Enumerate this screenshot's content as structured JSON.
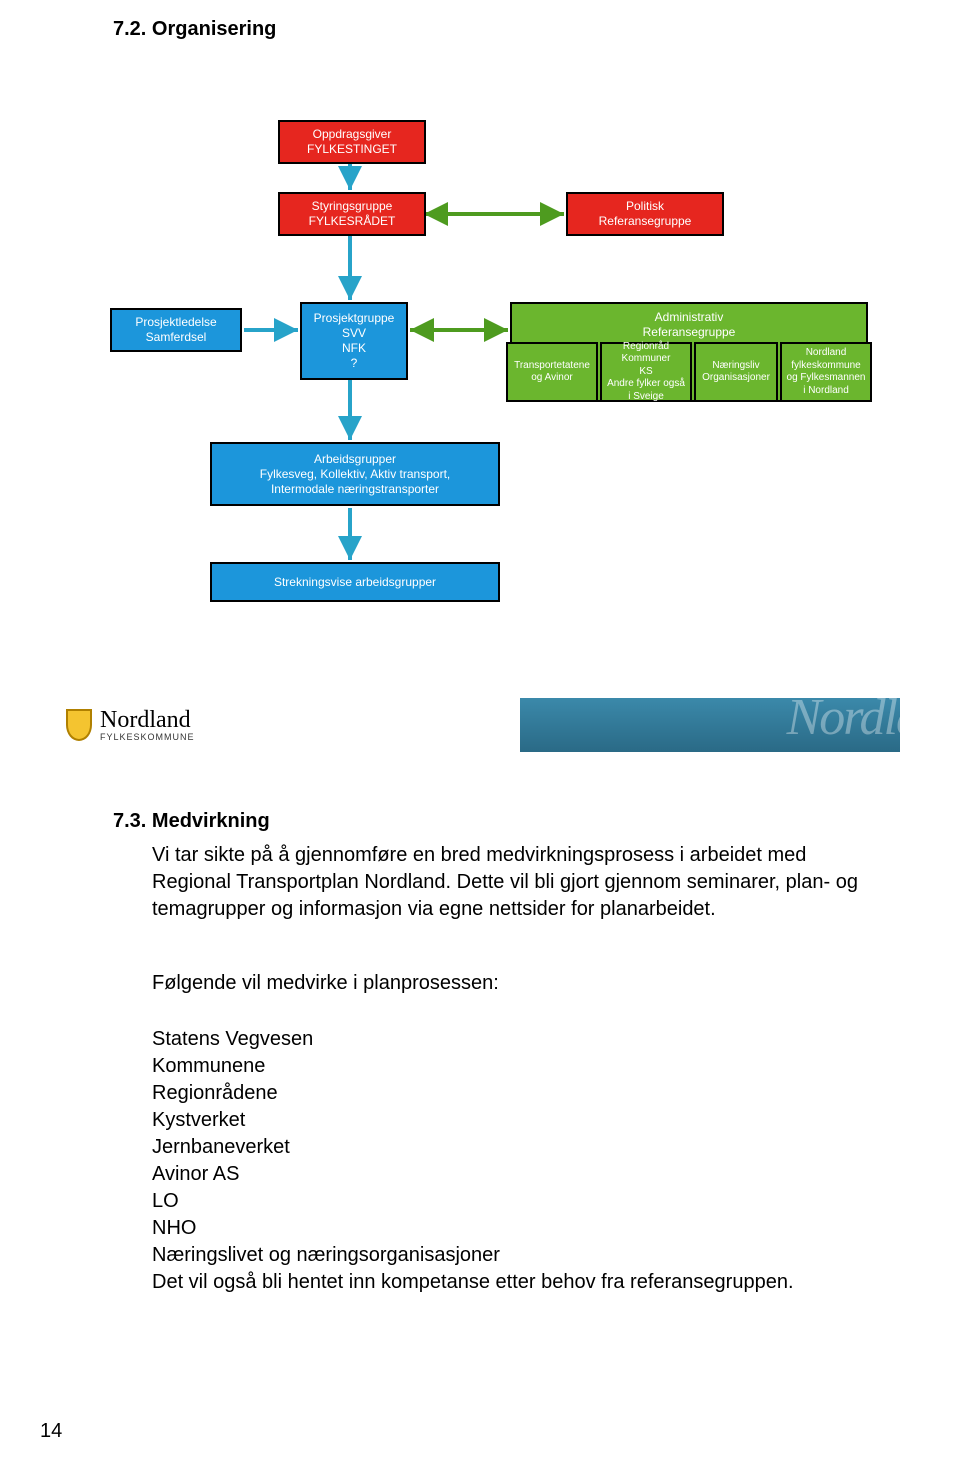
{
  "section1": {
    "number": "7.2.",
    "title": "Organisering"
  },
  "diagram": {
    "oppdragsgiver": {
      "line1": "Oppdragsgiver",
      "line2": "FYLKESTINGET"
    },
    "styringsgruppe": {
      "line1": "Styringsgruppe",
      "line2": "FYLKESRÅDET"
    },
    "politisk": {
      "line1": "Politisk",
      "line2": "Referansegruppe"
    },
    "prosjektledelse": {
      "line1": "Prosjektledelse",
      "line2": "Samferdsel"
    },
    "prosjektgruppe": {
      "line1": "Prosjektgruppe",
      "line2": "SVV",
      "line3": "NFK",
      "line4": "?"
    },
    "administrativ": {
      "line1": "Administrativ",
      "line2": "Referansegruppe"
    },
    "sub1": {
      "line1": "Transportetatene",
      "line2": "og Avinor"
    },
    "sub2": {
      "line1": "Regionråd",
      "line2": "Kommuner",
      "line3": "KS",
      "line4": "Andre fylker også",
      "line5": "i Sveige"
    },
    "sub3": {
      "line1": "Næringsliv",
      "line2": "Organisasjoner"
    },
    "sub4": {
      "line1": "Nordland",
      "line2": "fylkeskommune",
      "line3": "og Fylkesmannen",
      "line4": "i Nordland"
    },
    "arbeidsgrupper": {
      "line1": "Arbeidsgrupper",
      "line2": "Fylkesveg, Kollektiv, Aktiv transport,",
      "line3": "Intermodale næringstransporter"
    },
    "strekningsvise": {
      "line1": "Strekningsvise arbeidsgrupper"
    }
  },
  "banner": {
    "brand": "Nordland",
    "sub": "FYLKESKOMMUNE",
    "watermark": "Nordla"
  },
  "section2": {
    "number": "7.3.",
    "title": "Medvirkning",
    "para": "Vi tar sikte på å gjennomføre en bred medvirkningsprosess i arbeidet med Regional Transportplan Nordland. Dette vil bli gjort gjennom seminarer, plan- og temagrupper og informasjon via egne nettsider for planarbeidet.",
    "para2": "Følgende vil medvirke i planprosessen:",
    "list": [
      "Statens Vegvesen",
      "Kommunene",
      "Regionrådene",
      "Kystverket",
      "Jernbaneverket",
      "Avinor AS",
      "LO",
      "NHO",
      "Næringslivet og næringsorganisasjoner",
      "Det vil også bli hentet inn kompetanse etter behov fra referansegruppen."
    ]
  },
  "page_number": "14"
}
